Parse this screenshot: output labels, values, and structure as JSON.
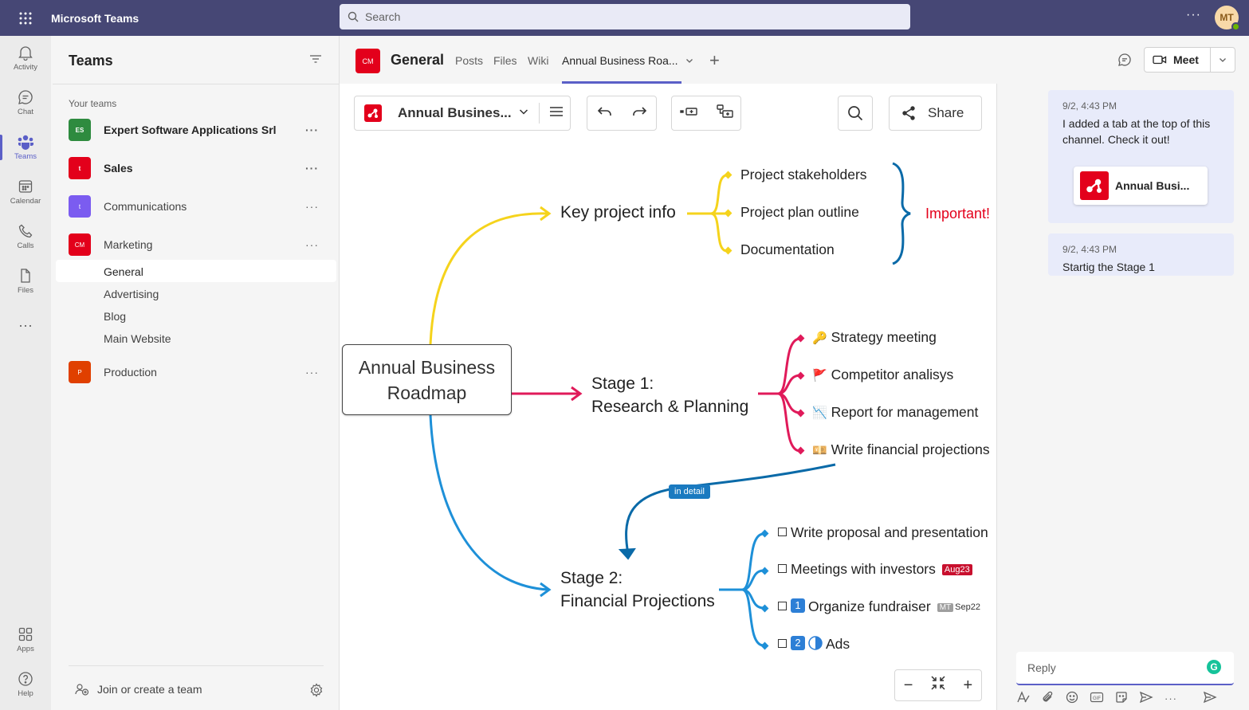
{
  "app": {
    "title": "Microsoft Teams",
    "search_placeholder": "Search",
    "user_initials": "MT"
  },
  "rail": [
    {
      "label": "Activity",
      "icon": "bell-icon"
    },
    {
      "label": "Chat",
      "icon": "chat-icon"
    },
    {
      "label": "Teams",
      "icon": "teams-icon",
      "active": true
    },
    {
      "label": "Calendar",
      "icon": "calendar-icon"
    },
    {
      "label": "Calls",
      "icon": "phone-icon"
    },
    {
      "label": "Files",
      "icon": "file-icon"
    },
    {
      "label": "Apps",
      "icon": "apps-icon"
    },
    {
      "label": "Help",
      "icon": "help-icon"
    }
  ],
  "sidebar": {
    "title": "Teams",
    "section_label": "Your teams",
    "teams": [
      {
        "initials": "ES",
        "name": "Expert Software Applications Srl",
        "color": "#2e8b3f"
      },
      {
        "initials": "t",
        "name": "Sales",
        "color": "#e3001b"
      },
      {
        "initials": "t",
        "name": "Communications",
        "color": "#7b5cf0"
      },
      {
        "initials": "CM",
        "name": "Marketing",
        "color": "#e3001b"
      },
      {
        "initials": "P",
        "name": "Production",
        "color": "#e04000"
      }
    ],
    "channels": [
      "General",
      "Advertising",
      "Blog",
      "Main Website"
    ],
    "join_label": "Join or create a team"
  },
  "header": {
    "channel_initials": "CM",
    "channel_name": "General",
    "tabs": [
      "Posts",
      "Files",
      "Wiki",
      "Annual Business Roa..."
    ],
    "meet_label": "Meet"
  },
  "mindmap_toolbar": {
    "title": "Annual Busines...",
    "share_label": "Share"
  },
  "mindmap": {
    "center": [
      "Annual Business",
      "Roadmap"
    ],
    "key_info": {
      "label": "Key project info",
      "items": [
        "Project stakeholders",
        "Project plan outline",
        "Documentation"
      ],
      "callout": "Important!"
    },
    "stage1": {
      "label_line1": "Stage 1:",
      "label_line2": "Research & Planning",
      "items": [
        {
          "icon": "🔑",
          "text": "Strategy meeting"
        },
        {
          "icon": "🚩",
          "text": "Competitor analisys"
        },
        {
          "icon": "📉",
          "text": "Report for management"
        },
        {
          "icon": "💴",
          "text": "Write financial projections"
        }
      ]
    },
    "relationship_label": "in detail",
    "stage2": {
      "label_line1": "Stage 2:",
      "label_line2": "Financial Projections",
      "items": [
        {
          "text": "Write proposal and presentation"
        },
        {
          "text": "Meetings with investors",
          "badge": "Aug23"
        },
        {
          "number": "1",
          "text": "Organize fundraiser",
          "assignee": "MT",
          "date": "Sep22"
        },
        {
          "number": "2",
          "text": "Ads"
        }
      ]
    },
    "colors": {
      "key_info": "#f5d31c",
      "stage1": "#e01a5a",
      "stage2": "#1e90d8",
      "relationship": "#0a6aa8",
      "brace": "#0a6aa8"
    }
  },
  "conversation": {
    "messages": [
      {
        "time": "9/2, 4:43 PM",
        "text": "I added a tab at the top of this channel. Check it out!",
        "card_label": "Annual Busi..."
      },
      {
        "time": "9/2, 4:43 PM",
        "text": "Startig the Stage 1"
      }
    ],
    "reply_placeholder": "Reply"
  }
}
